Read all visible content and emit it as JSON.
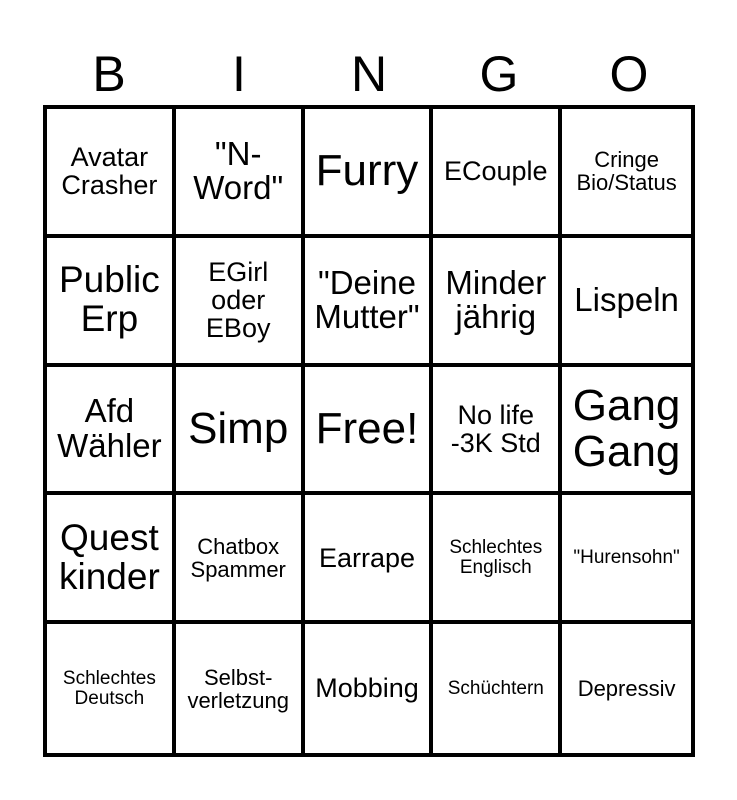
{
  "header": {
    "letters": [
      "B",
      "I",
      "N",
      "G",
      "O"
    ]
  },
  "board": {
    "rows": [
      [
        "Avatar\nCrasher",
        "\"N-\nWord\"",
        "Furry",
        "ECouple",
        "Cringe\nBio/Status"
      ],
      [
        "Public\nErp",
        "EGirl\noder\nEBoy",
        "\"Deine\nMutter\"",
        "Minder\njährig",
        "Lispeln"
      ],
      [
        "Afd\nWähler",
        "Simp",
        "Free!",
        "No life\n-3K Std",
        "Gang\nGang"
      ],
      [
        "Quest\nkinder",
        "Chatbox\nSpammer",
        "Earrape",
        "Schlechtes\nEnglisch",
        "\"Hurensohn\""
      ],
      [
        "Schlechtes\nDeutsch",
        "Selbst-\nverletzung",
        "Mobbing",
        "Schüchtern",
        "Depressiv"
      ]
    ]
  }
}
